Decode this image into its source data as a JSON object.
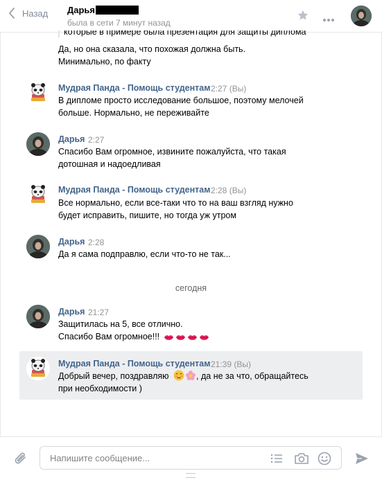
{
  "header": {
    "back_label": "Назад",
    "peer_name": "Дарья",
    "peer_status": "была в сети 7 минут назад"
  },
  "quote_fragment": "которые в примере была презентация для защиты диплома",
  "messages": [
    {
      "lines": [
        "Да, но она сказала, что похожая должна быть.",
        "Минимально, по факту"
      ]
    },
    {
      "author": "Мудрая Панда - Помощь студентам",
      "time": "2:27",
      "mark": "(Вы)",
      "lines": [
        "В дипломе просто исследование большое, поэтому мелочей",
        "больше. Нормально, не переживайте"
      ]
    },
    {
      "author": "Дарья",
      "time": "2:27",
      "lines": [
        "Спасибо Вам огромное, извините пожалуйста, что такая",
        "дотошная и надоедливая"
      ]
    },
    {
      "author": "Мудрая Панда - Помощь студентам",
      "time": "2:28",
      "mark": "(Вы)",
      "lines": [
        "Все нормально, если все-таки что то на ваш взгляд нужно",
        "будет исправить, пишите, но тогда уж утром"
      ]
    },
    {
      "author": "Дарья",
      "time": "2:28",
      "lines": [
        "Да я сама подправлю, если что-то не так..."
      ]
    },
    {
      "author": "Дарья",
      "time": "21:27",
      "lines": [
        "Защитилась на 5, все отлично.",
        "Спасибо Вам огромное!!!"
      ]
    },
    {
      "author": "Мудрая Панда - Помощь студентам",
      "time": "21:39",
      "mark": "(Вы)",
      "lines": [
        "Добрый вечер, поздравляю",
        ", да не за что, обращайтесь",
        "при необходимости )"
      ]
    }
  ],
  "date_separator": "сегодня",
  "composer": {
    "placeholder": "Напишите сообщение..."
  },
  "colors": {
    "author": "#42648b",
    "highlight": "#edeef0",
    "meta": "#939393",
    "lips": "#e0245e"
  },
  "icons": [
    "chevron-left-icon",
    "star-icon",
    "more-icon",
    "paperclip-icon",
    "list-icon",
    "camera-icon",
    "smile-icon",
    "send-icon",
    "kiss-lips-icon",
    "blush-smile-emoji",
    "flower-emoji"
  ]
}
